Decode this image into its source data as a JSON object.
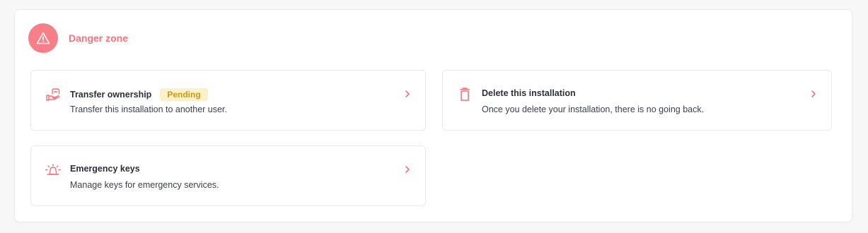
{
  "danger_zone": {
    "title": "Danger zone",
    "accent_color": "#f77f87",
    "header_icon": "warning-triangle-icon"
  },
  "cards": [
    {
      "id": "transfer",
      "title": "Transfer ownership",
      "badge": "Pending",
      "description": "Transfer this installation to another user.",
      "icon": "hand-transfer-icon"
    },
    {
      "id": "delete",
      "title": "Delete this installation",
      "description": "Once you delete your installation, there is no going back.",
      "icon": "trash-icon"
    },
    {
      "id": "emergency",
      "title": "Emergency keys",
      "description": "Manage keys for emergency services.",
      "icon": "siren-icon"
    }
  ]
}
